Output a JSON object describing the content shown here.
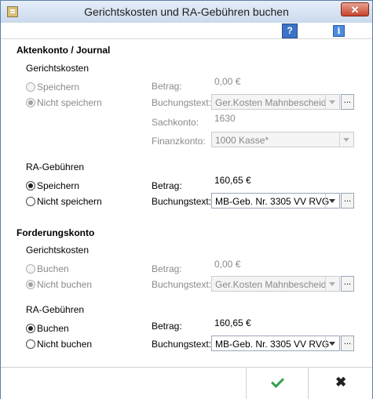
{
  "window": {
    "title": "Gerichtskosten und RA-Gebühren buchen"
  },
  "toolbar": {
    "help_label": "?",
    "info_label": "i"
  },
  "aktenkonto": {
    "heading": "Aktenkonto / Journal",
    "gerichtskosten": {
      "label": "Gerichtskosten",
      "option_save": "Speichern",
      "option_nosave": "Nicht speichern",
      "selected": "Nicht speichern",
      "betrag_label": "Betrag:",
      "betrag_value": "0,00 €",
      "buchungstext_label": "Buchungstext:",
      "buchungstext_value": "Ger.Kosten Mahnbescheid",
      "sachkonto_label": "Sachkonto:",
      "sachkonto_value": "1630",
      "finanzkonto_label": "Finanzkonto:",
      "finanzkonto_value": "1000 Kasse*"
    },
    "ra_gebuehren": {
      "label": "RA-Gebühren",
      "option_save": "Speichern",
      "option_nosave": "Nicht speichern",
      "selected": "Speichern",
      "betrag_label": "Betrag:",
      "betrag_value": "160,65 €",
      "buchungstext_label": "Buchungstext:",
      "buchungstext_value": "MB-Geb. Nr. 3305 VV RVG"
    }
  },
  "forderungskonto": {
    "heading": "Forderungskonto",
    "gerichtskosten": {
      "label": "Gerichtskosten",
      "option_book": "Buchen",
      "option_nobook": "Nicht buchen",
      "selected": "Nicht buchen",
      "betrag_label": "Betrag:",
      "betrag_value": "0,00 €",
      "buchungstext_label": "Buchungstext:",
      "buchungstext_value": "Ger.Kosten Mahnbescheid"
    },
    "ra_gebuehren": {
      "label": "RA-Gebühren",
      "option_book": "Buchen",
      "option_nobook": "Nicht buchen",
      "selected": "Buchen",
      "betrag_label": "Betrag:",
      "betrag_value": "160,65 €",
      "buchungstext_label": "Buchungstext:",
      "buchungstext_value": "MB-Geb. Nr. 3305 VV RVG"
    }
  },
  "buttons": {
    "browse_label": "..."
  },
  "colors": {
    "accent": "#3b73c7",
    "ok_green": "#33a04f",
    "disabled_text": "#8a8a8a"
  }
}
